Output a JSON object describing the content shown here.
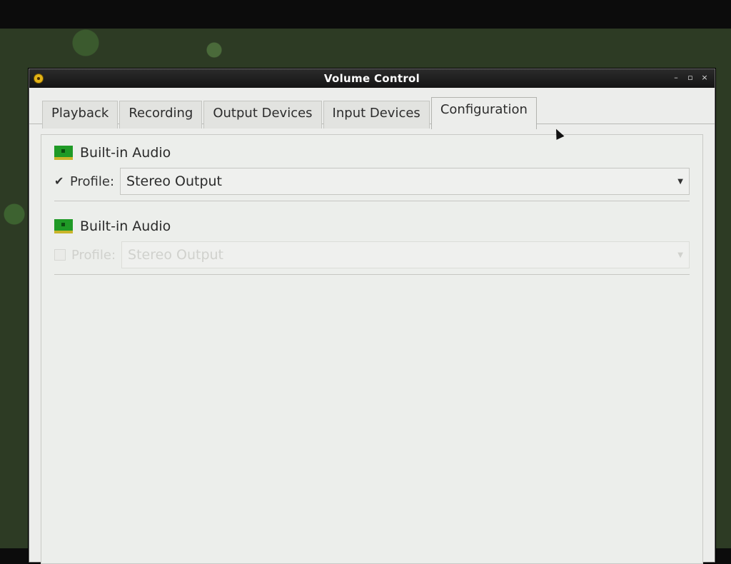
{
  "window": {
    "title": "Volume Control",
    "controls": {
      "minimize": "–",
      "maximize": "▫",
      "close": "×"
    }
  },
  "tabs": [
    {
      "label": "Playback",
      "mnemonic": "P",
      "active": false
    },
    {
      "label": "Recording",
      "mnemonic": "R",
      "active": false
    },
    {
      "label": "Output Devices",
      "mnemonic": "O",
      "active": false
    },
    {
      "label": "Input Devices",
      "mnemonic": "I",
      "active": false
    },
    {
      "label": "Configuration",
      "mnemonic": "C",
      "active": true
    }
  ],
  "cards": [
    {
      "title": "Built-in Audio",
      "icon": "sound-card-icon",
      "profile_label": "Profile:",
      "profile_value": "Stereo Output",
      "checked": true,
      "check_glyph": "✔",
      "enabled": true
    },
    {
      "title": "Built-in Audio",
      "icon": "sound-card-icon",
      "profile_label": "Profile:",
      "profile_value": "Stereo Output",
      "checked": false,
      "check_glyph": "",
      "enabled": false
    }
  ],
  "combo_arrow": "▼"
}
